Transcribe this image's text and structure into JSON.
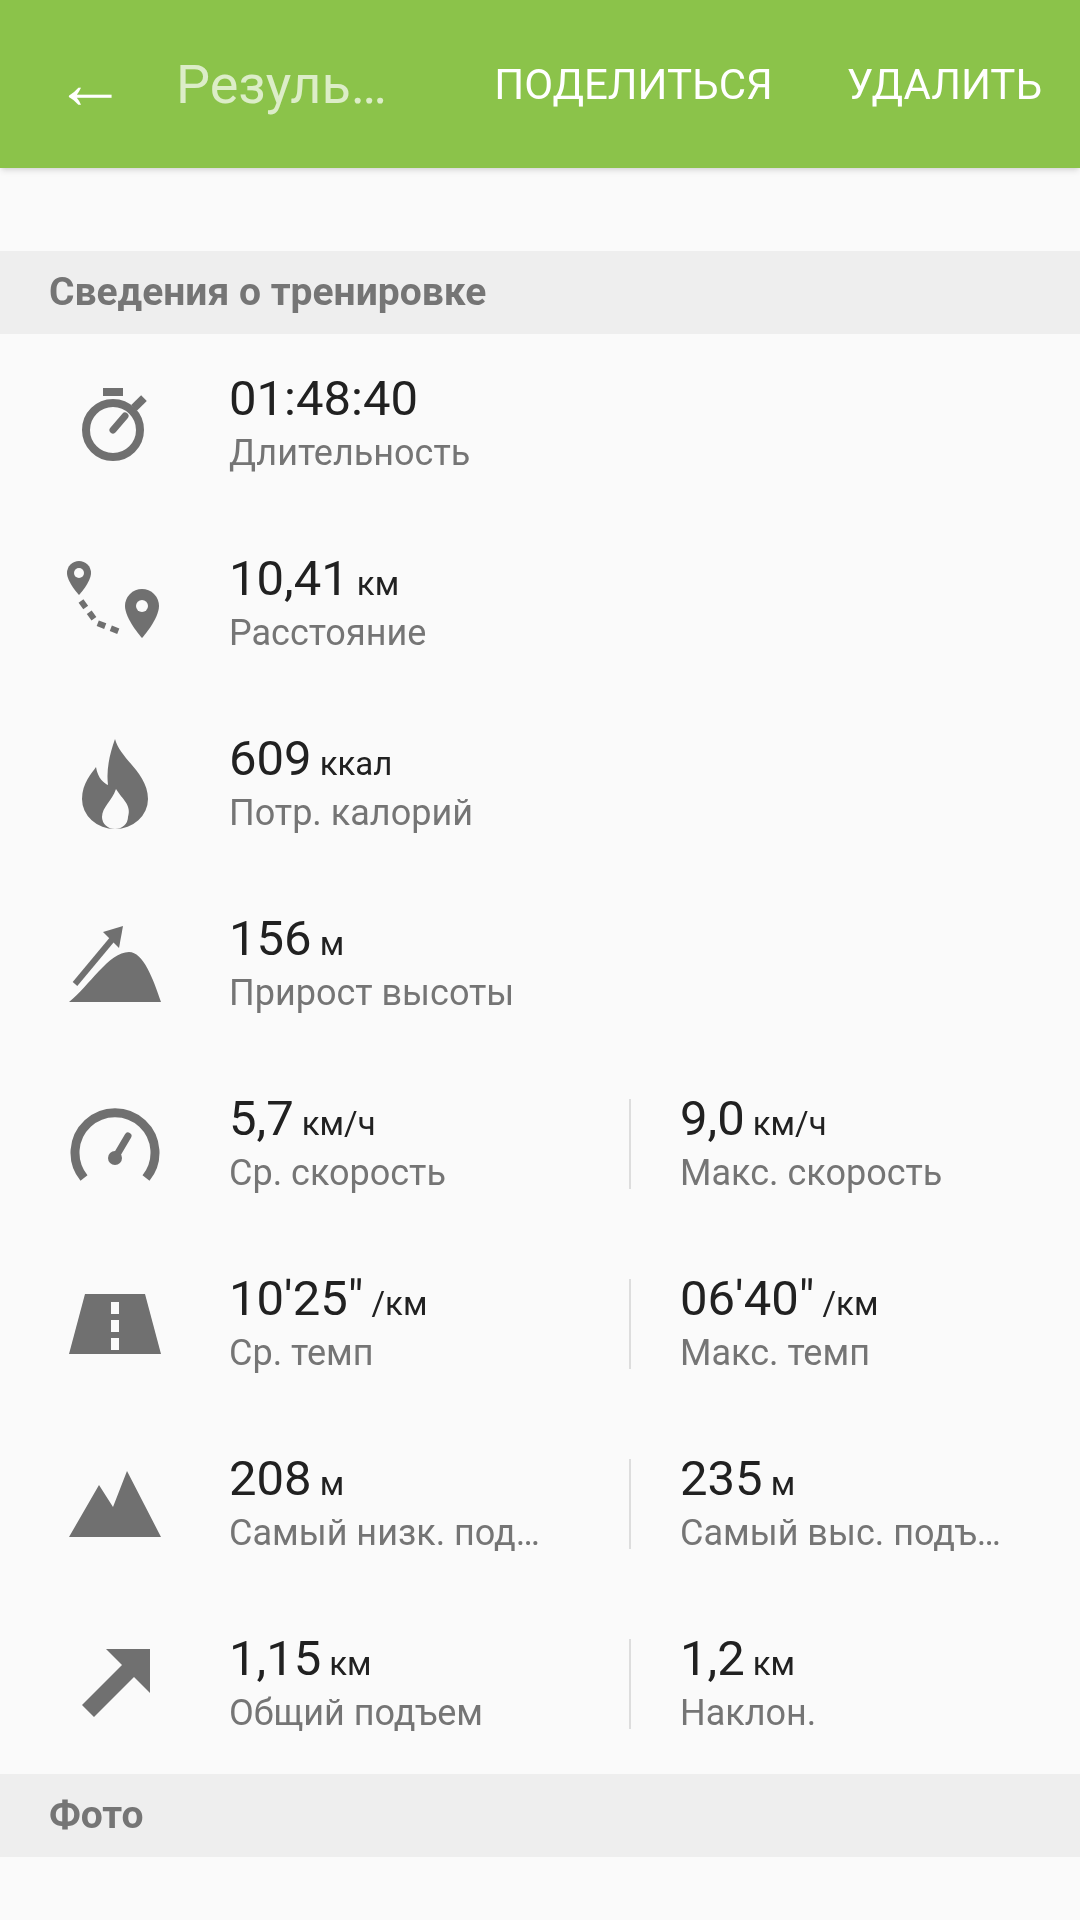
{
  "app_bar": {
    "back": "←",
    "title": "Резуль…",
    "actions": [
      "ПОДЕЛИТЬСЯ",
      "УДАЛИТЬ"
    ]
  },
  "sections": [
    {
      "title": "Сведения о тренировке",
      "rows": [
        {
          "items": [
            {
              "value": "01:48:40",
              "label": "Длительность"
            }
          ]
        },
        {
          "items": [
            {
              "value": "10,41",
              "unit": "км",
              "label": "Расстояние"
            }
          ]
        },
        {
          "items": [
            {
              "value": "609",
              "unit": "ккал",
              "label": "Потр. калорий"
            }
          ]
        },
        {
          "items": [
            {
              "value": "156",
              "unit": "м",
              "label": "Прирост высоты"
            }
          ]
        },
        {
          "items": [
            {
              "value": "5,7",
              "unit": "км/ч",
              "label": "Ср. скорость"
            },
            {
              "value": "9,0",
              "unit": "км/ч",
              "label": "Макс. скорость"
            }
          ]
        },
        {
          "items": [
            {
              "value": "10'25\"",
              "unit": "/км",
              "label": "Ср. темп"
            },
            {
              "value": "06'40\"",
              "unit": "/км",
              "label": "Макс. темп"
            }
          ]
        },
        {
          "items": [
            {
              "value": "208",
              "unit": "м",
              "label": "Самый низк. под…"
            },
            {
              "value": "235",
              "unit": "м",
              "label": "Самый выс. подъ…"
            }
          ]
        },
        {
          "items": [
            {
              "value": "1,15",
              "unit": "км",
              "label": "Общий подъем"
            },
            {
              "value": "1,2",
              "unit": "км",
              "label": "Наклон."
            }
          ]
        }
      ]
    },
    {
      "title": "Фото"
    }
  ]
}
